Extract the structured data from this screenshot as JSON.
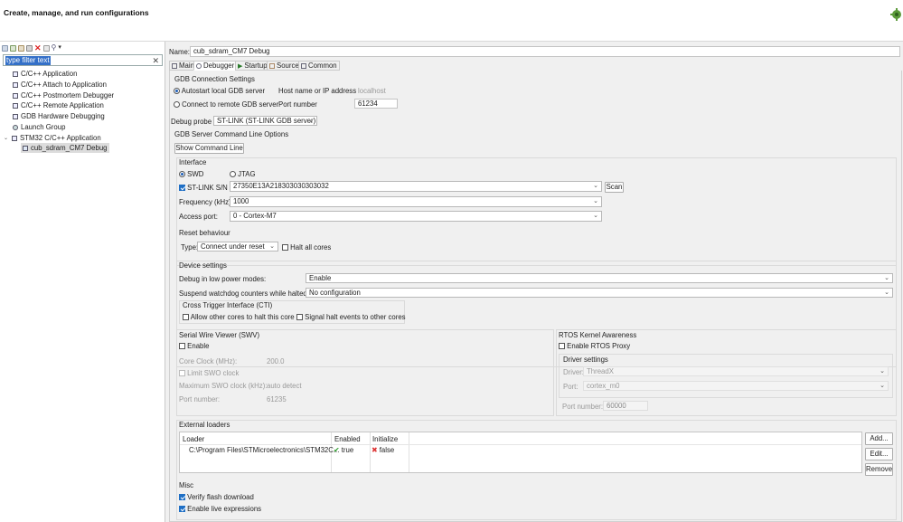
{
  "header": {
    "title": "Create, manage, and run configurations"
  },
  "left": {
    "filter_placeholder": "type filter text",
    "tree": [
      {
        "label": "C/C++ Application"
      },
      {
        "label": "C/C++ Attach to Application"
      },
      {
        "label": "C/C++ Postmortem Debugger"
      },
      {
        "label": "C/C++ Remote Application"
      },
      {
        "label": "GDB Hardware Debugging"
      },
      {
        "label": "Launch Group"
      },
      {
        "label": "STM32 C/C++ Application"
      },
      {
        "label": "cub_sdram_CM7 Debug"
      }
    ]
  },
  "config": {
    "name_label": "Name:",
    "name_value": "cub_sdram_CM7 Debug"
  },
  "tabs": [
    {
      "label": "Main"
    },
    {
      "label": "Debugger"
    },
    {
      "label": "Startup"
    },
    {
      "label": "Source"
    },
    {
      "label": "Common"
    }
  ],
  "gdb": {
    "section": "GDB Connection Settings",
    "autostart": "Autostart local GDB server",
    "remote": "Connect to remote GDB server",
    "host_label": "Host name or IP address",
    "host_value": "localhost",
    "port_label": "Port number",
    "port_value": "61234"
  },
  "probe": {
    "label": "Debug probe",
    "value": "ST-LINK (ST-LINK GDB server)"
  },
  "server": {
    "section": "GDB Server Command Line Options",
    "show_cmd": "Show Command Line"
  },
  "interface": {
    "section": "Interface",
    "swd": "SWD",
    "jtag": "JTAG",
    "stlink_label": "ST-LINK S/N",
    "stlink_value": "27350E13A218303030303032",
    "scan": "Scan",
    "freq_label": "Frequency (kHz):",
    "freq_value": "1000",
    "access_label": "Access port:",
    "access_value": "0 - Cortex-M7"
  },
  "reset": {
    "section": "Reset behaviour",
    "type_label": "Type:",
    "type_value": "Connect under reset",
    "halt_all": "Halt all cores"
  },
  "device": {
    "section": "Device settings",
    "lowpower_label": "Debug in low power modes:",
    "lowpower_value": "Enable",
    "watchdog_label": "Suspend watchdog counters while halted:",
    "watchdog_value": "No configuration",
    "cti_section": "Cross Trigger Interface (CTI)",
    "cti_allow": "Allow other cores to halt this core",
    "cti_signal": "Signal halt events to other cores"
  },
  "swv": {
    "section": "Serial Wire Viewer (SWV)",
    "enable": "Enable",
    "core_clock_label": "Core Clock (MHz):",
    "core_clock_value": "200.0",
    "limit": "Limit SWO clock",
    "max_label": "Maximum SWO clock (kHz):",
    "max_value": "auto detect",
    "port_label": "Port number:",
    "port_value": "61235"
  },
  "rtos": {
    "section": "RTOS Kernel Awareness",
    "enable": "Enable RTOS Proxy",
    "driver_section": "Driver settings",
    "driver_label": "Driver:",
    "driver_value": "ThreadX",
    "port_label": "Port:",
    "port_value": "cortex_m0",
    "portnum_label": "Port number:",
    "portnum_value": "60000"
  },
  "loaders": {
    "section": "External loaders",
    "headers": [
      "Loader",
      "Enabled",
      "Initialize"
    ],
    "rows": [
      {
        "loader": "C:\\Program Files\\STMicroelectronics\\STM32C...",
        "enabled": "true",
        "initialize": "false"
      }
    ],
    "add": "Add...",
    "edit": "Edit...",
    "remove": "Remove"
  },
  "misc": {
    "section": "Misc",
    "verify": "Verify flash download",
    "live": "Enable live expressions"
  }
}
